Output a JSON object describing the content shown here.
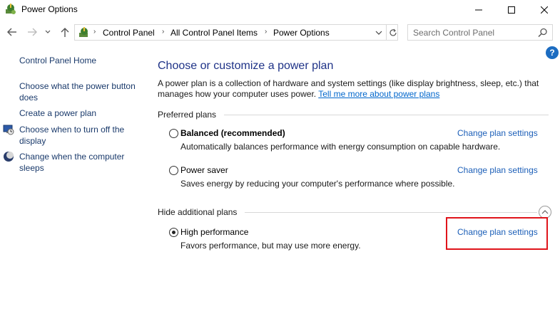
{
  "window": {
    "title": "Power Options"
  },
  "address_bar": {
    "crumbs": [
      "Control Panel",
      "All Control Panel Items",
      "Power Options"
    ]
  },
  "search": {
    "placeholder": "Search Control Panel"
  },
  "sidebar": {
    "home": "Control Panel Home",
    "links": [
      {
        "label_line1": "Choose what the power button",
        "label_line2": "does"
      },
      {
        "label_line1": "Create a power plan",
        "label_line2": ""
      },
      {
        "label_line1": "Choose when to turn off the",
        "label_line2": "display"
      },
      {
        "label_line1": "Change when the computer",
        "label_line2": "sleeps"
      }
    ]
  },
  "main": {
    "title": "Choose or customize a power plan",
    "intro_text": "A power plan is a collection of hardware and system settings (like display brightness, sleep, etc.) that manages how your computer uses power. ",
    "intro_link": "Tell me more about power plans",
    "preferred_heading": "Preferred plans",
    "hidden_heading": "Hide additional plans",
    "plans": [
      {
        "name": "Balanced (recommended)",
        "desc": "Automatically balances performance with energy consumption on capable hardware.",
        "link": "Change plan settings",
        "selected": false
      },
      {
        "name": "Power saver",
        "desc": "Saves energy by reducing your computer's performance where possible.",
        "link": "Change plan settings",
        "selected": false
      },
      {
        "name": "High performance",
        "desc": "Favors performance, but may use more energy.",
        "link": "Change plan settings",
        "selected": true
      }
    ]
  },
  "colors": {
    "link_blue": "#1c5fb8",
    "title_blue": "#1e3287",
    "highlight_red": "#e0141b"
  }
}
